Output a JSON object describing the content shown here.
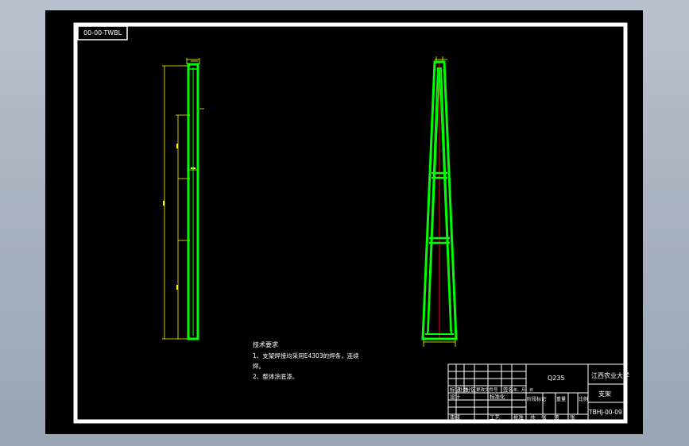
{
  "drawing_number_tag": "00-00-TWBL",
  "tech_requirements": {
    "heading": "技术要求",
    "line1": "1、支架焊接均采用E4303的焊条，连续",
    "line1b": "焊。",
    "line2": "2、整体涂底漆。"
  },
  "title_block": {
    "material": "Q235",
    "organization": "江西农业大学",
    "part_name": "支架",
    "drawing_number": "TBHJ-00-09",
    "left_labels": [
      "标记",
      "处数",
      "分区",
      "更改文件号",
      "签名",
      "年、月、日"
    ],
    "design_row": [
      "设计",
      "标准化"
    ],
    "stage_row": [
      "阶段标记",
      "重量",
      "比例"
    ],
    "bottom_row": [
      "审核",
      "工艺",
      "批准"
    ],
    "sheet_row": [
      "共",
      "张",
      "第",
      "张"
    ]
  },
  "colors": {
    "part_outline": "#00ff00",
    "dimension": "#ffff00",
    "centerline": "#ff0000",
    "frame": "#ffffff",
    "background": "#000000"
  }
}
